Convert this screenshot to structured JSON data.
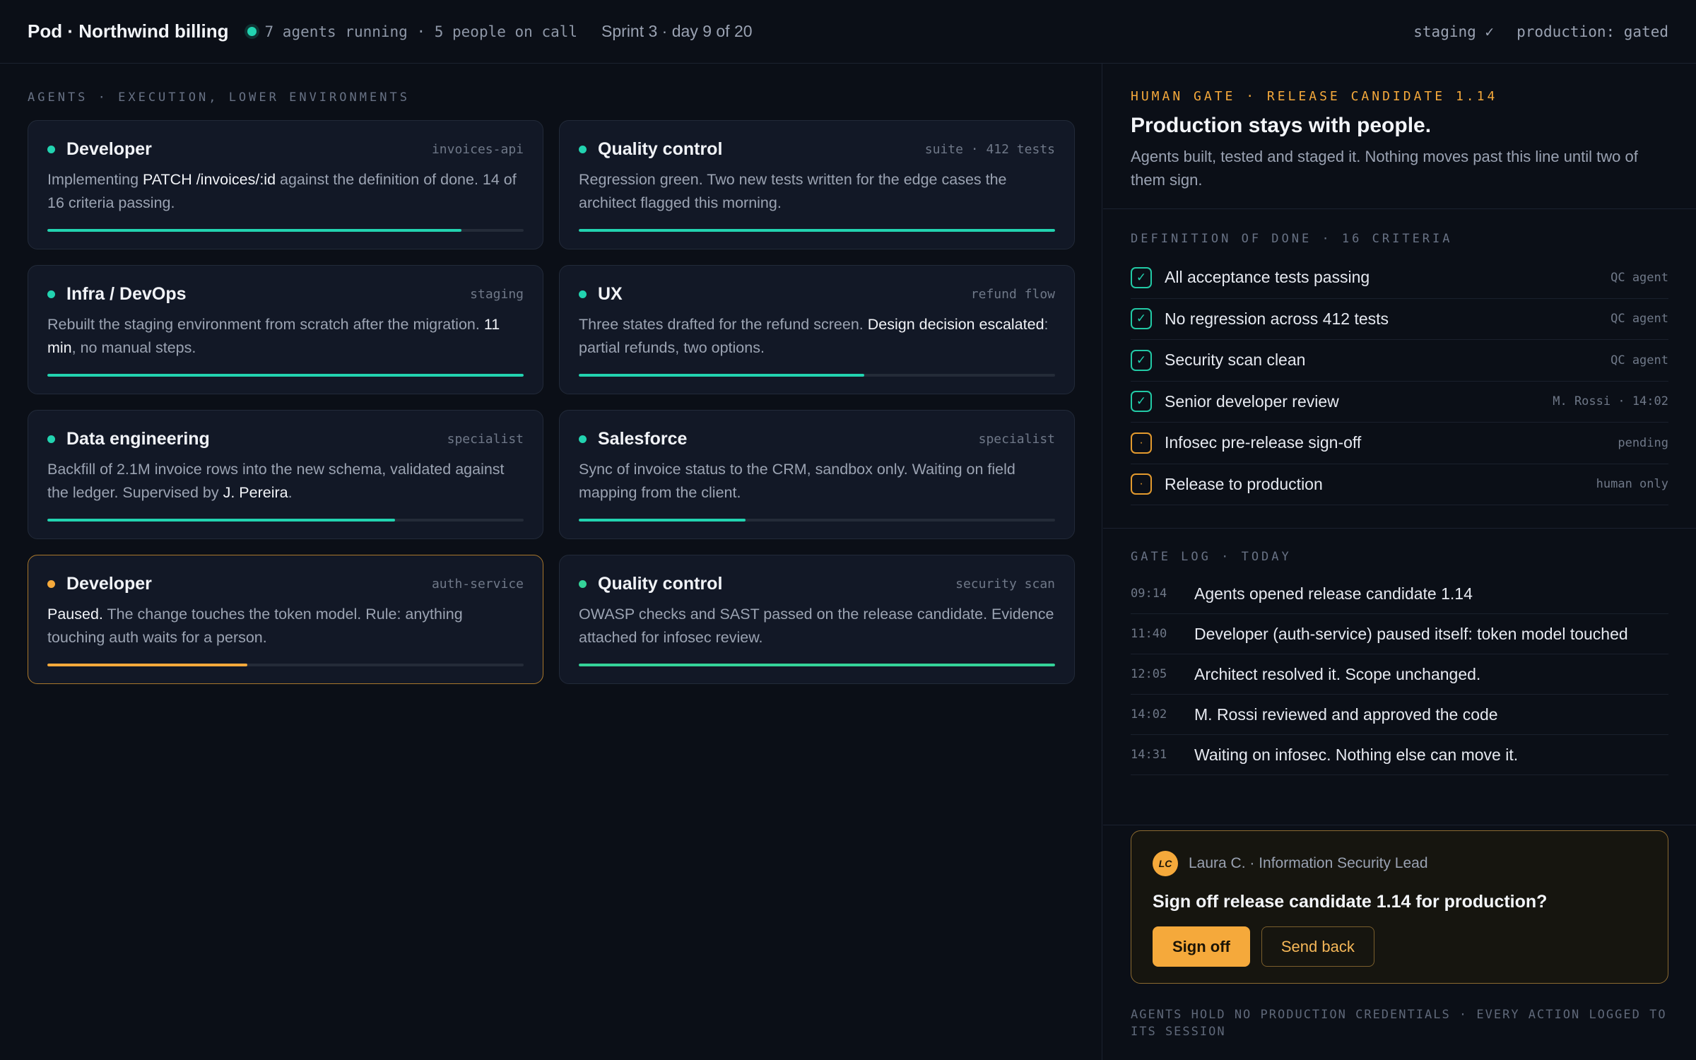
{
  "topbar": {
    "title": "Pod · Northwind billing",
    "running": "7 agents running · 5 people on call",
    "sprint": "Sprint 3 · day 9 of 20",
    "staging": "staging ✓",
    "production": "production: gated"
  },
  "agents": {
    "section_label": "AGENTS · EXECUTION, LOWER ENVIRONMENTS",
    "cards": [
      {
        "title": "Developer",
        "tag": "invoices-api",
        "status": "active",
        "progress": 0.87,
        "body": [
          {
            "t": "Implementing ",
            "hl": false
          },
          {
            "t": "PATCH /invoices/:id",
            "hl": true
          },
          {
            "t": " against the definition of done. 14 of 16 criteria passing.",
            "hl": false
          }
        ]
      },
      {
        "title": "Quality control",
        "tag": "suite · 412 tests",
        "status": "active",
        "progress": 1.0,
        "body": [
          {
            "t": "Regression green. Two new tests written for the edge cases the architect flagged this morning.",
            "hl": false
          }
        ]
      },
      {
        "title": "Infra / DevOps",
        "tag": "staging",
        "status": "active",
        "progress": 1.0,
        "body": [
          {
            "t": "Rebuilt the staging environment from scratch after the migration. ",
            "hl": false
          },
          {
            "t": "11 min",
            "hl": true
          },
          {
            "t": ", no manual steps.",
            "hl": false
          }
        ]
      },
      {
        "title": "UX",
        "tag": "refund flow",
        "status": "active",
        "progress": 0.6,
        "body": [
          {
            "t": "Three states drafted for the refund screen. ",
            "hl": false
          },
          {
            "t": "Design decision escalated",
            "hl": true
          },
          {
            "t": ": partial refunds, two options.",
            "hl": false
          }
        ]
      },
      {
        "title": "Data engineering",
        "tag": "specialist",
        "status": "active",
        "progress": 0.73,
        "body": [
          {
            "t": "Backfill of 2.1M invoice rows into the new schema, validated against the ledger. Supervised by ",
            "hl": false
          },
          {
            "t": "J. Pereira",
            "hl": true
          },
          {
            "t": ".",
            "hl": false
          }
        ]
      },
      {
        "title": "Salesforce",
        "tag": "specialist",
        "status": "active",
        "progress": 0.35,
        "body": [
          {
            "t": "Sync of invoice status to the CRM, sandbox only. Waiting on field mapping from the client.",
            "hl": false
          }
        ]
      },
      {
        "title": "Developer",
        "tag": "auth-service",
        "status": "paused",
        "progress": 0.42,
        "body": [
          {
            "t": "Paused.",
            "hl": true
          },
          {
            "t": " The change touches the token model. Rule: anything touching auth waits for a person.",
            "hl": false
          }
        ]
      },
      {
        "title": "Quality control",
        "tag": "security scan",
        "status": "done",
        "progress": 1.0,
        "body": [
          {
            "t": "OWASP checks and SAST passed on the release candidate. Evidence attached for infosec review.",
            "hl": false
          }
        ]
      }
    ]
  },
  "gate": {
    "label": "HUMAN GATE · RELEASE CANDIDATE 1.14",
    "title": "Production stays with people.",
    "subtitle": "Agents built, tested and staged it. Nothing moves past this line until two of them sign."
  },
  "dod": {
    "label": "DEFINITION OF DONE · 16 CRITERIA",
    "items": [
      {
        "text": "All acceptance tests passing",
        "owner": "QC agent",
        "state": "done",
        "mark": "✓"
      },
      {
        "text": "No regression across 412 tests",
        "owner": "QC agent",
        "state": "done",
        "mark": "✓"
      },
      {
        "text": "Security scan clean",
        "owner": "QC agent",
        "state": "done",
        "mark": "✓"
      },
      {
        "text": "Senior developer review",
        "owner": "M. Rossi · 14:02",
        "state": "done",
        "mark": "✓"
      },
      {
        "text": "Infosec pre-release sign-off",
        "owner": "pending",
        "state": "pending",
        "mark": "·"
      },
      {
        "text": "Release to production",
        "owner": "human only",
        "state": "pending",
        "mark": "·"
      }
    ]
  },
  "log": {
    "label": "GATE LOG · TODAY",
    "items": [
      {
        "time": "09:14",
        "text": "Agents opened release candidate 1.14"
      },
      {
        "time": "11:40",
        "text": "Developer (auth-service) paused itself: token model touched"
      },
      {
        "time": "12:05",
        "text": "Architect resolved it. Scope unchanged."
      },
      {
        "time": "14:02",
        "text": "M. Rossi reviewed and approved the code"
      },
      {
        "time": "14:31",
        "text": "Waiting on infosec. Nothing else can move it."
      }
    ]
  },
  "signoff": {
    "avatar_initials": "LC",
    "requester": "Laura C. · Information Security Lead",
    "question": "Sign off release candidate 1.14 for production?",
    "primary_label": "Sign off",
    "secondary_label": "Send back"
  },
  "footer_note": "AGENTS HOLD NO PRODUCTION CREDENTIALS · EVERY ACTION LOGGED TO ITS SESSION",
  "colors": {
    "background": "#0b0f17",
    "accent_teal": "#22d3b0",
    "accent_amber": "#f5a93b",
    "accent_green": "#34d399"
  }
}
